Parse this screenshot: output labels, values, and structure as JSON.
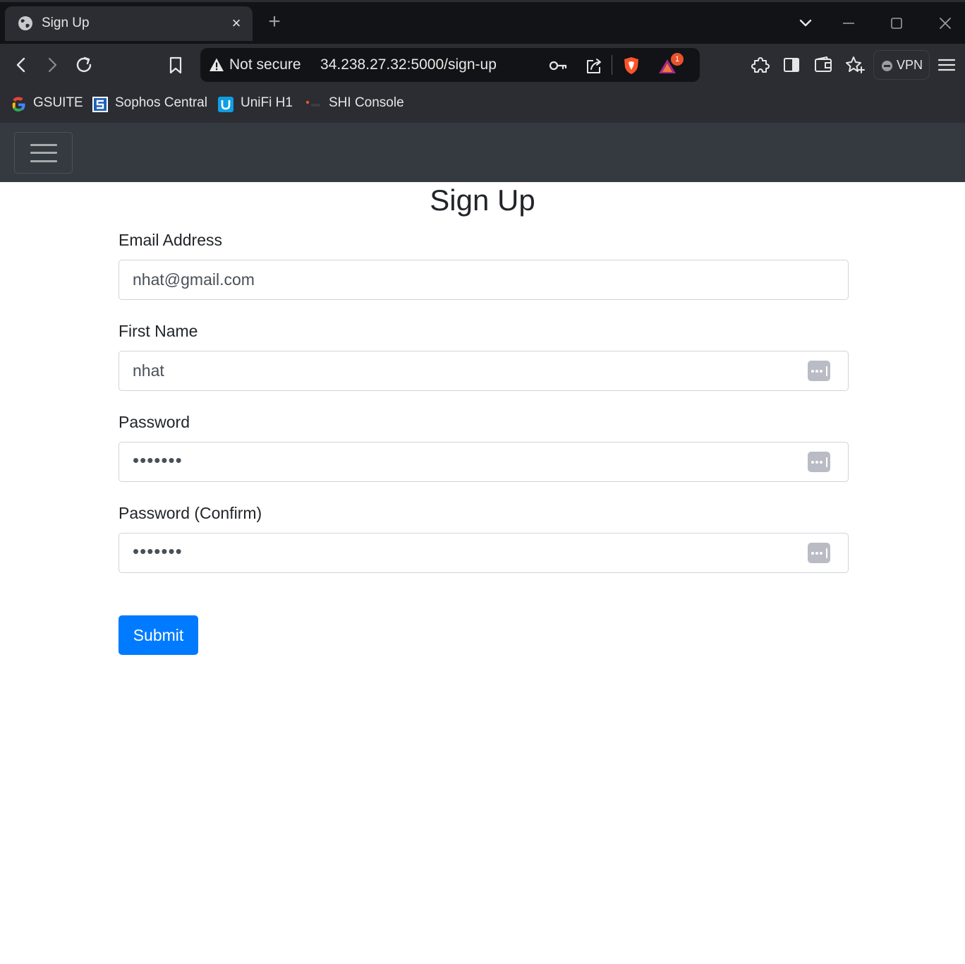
{
  "browser": {
    "tab": {
      "title": "Sign Up",
      "close_label": "×"
    },
    "new_tab_label": "+",
    "address_bar": {
      "security_label": "Not secure",
      "url": "34.238.27.32:5000/sign-up",
      "alert_badge_count": "1"
    },
    "vpn_label": "VPN",
    "bookmarks": [
      {
        "label": "GSUITE",
        "icon": "google-icon"
      },
      {
        "label": "Sophos Central",
        "icon": "sophos-icon"
      },
      {
        "label": "UniFi H1",
        "icon": "unifi-icon"
      },
      {
        "label": "SHI Console",
        "icon": "shi-icon"
      }
    ]
  },
  "page": {
    "title": "Sign Up",
    "fields": {
      "email": {
        "label": "Email Address",
        "value": "nhat@gmail.com"
      },
      "first_name": {
        "label": "First Name",
        "value": "nhat"
      },
      "password": {
        "label": "Password",
        "value": "•••••••"
      },
      "password_confirm": {
        "label": "Password (Confirm)",
        "value": "•••••••"
      }
    },
    "submit_label": "Submit"
  },
  "colors": {
    "navbar": "#343a40",
    "primary_button": "#007bff",
    "browser_dark": "#121316",
    "browser_toolbar": "#2b2d33"
  }
}
